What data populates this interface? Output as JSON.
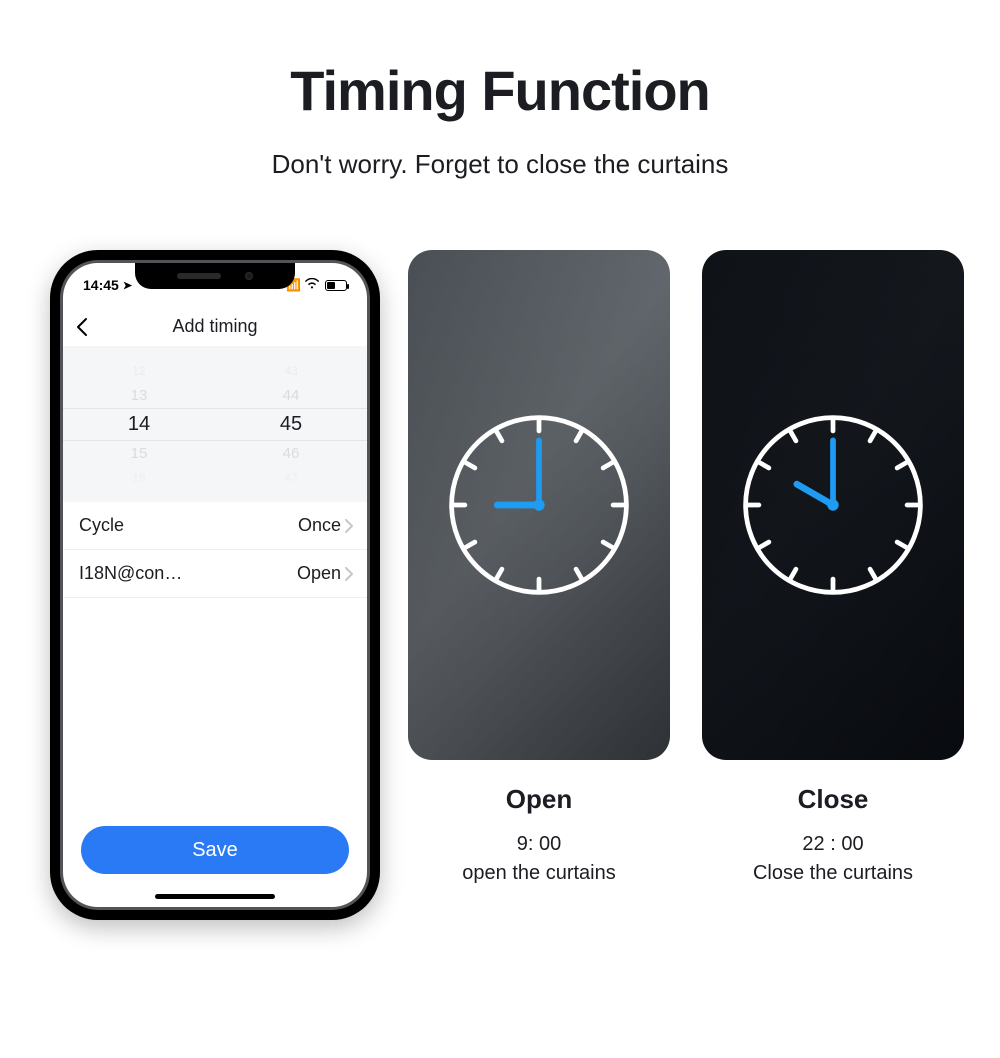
{
  "hero": {
    "title": "Timing Function",
    "subtitle": "Don't worry. Forget to close the curtains"
  },
  "phone": {
    "status_time": "14:45",
    "app_title": "Add timing",
    "picker": {
      "hours": {
        "minus2": "12",
        "minus1": "13",
        "selected": "14",
        "plus1": "15",
        "plus2": "16"
      },
      "minutes": {
        "minus2": "43",
        "minus1": "44",
        "selected": "45",
        "plus1": "46",
        "plus2": "47"
      }
    },
    "rows": [
      {
        "label": "Cycle",
        "value": "Once"
      },
      {
        "label": "I18N@con…",
        "value": "Open"
      }
    ],
    "save_label": "Save"
  },
  "panels": [
    {
      "title": "Open",
      "time": "9: 00",
      "caption": "open the curtains",
      "clock_hour_angle": -90,
      "clock_min_angle": 0,
      "variant": "day"
    },
    {
      "title": "Close",
      "time": "22 : 00",
      "caption": "Close the curtains",
      "clock_hour_angle": -60,
      "clock_min_angle": 0,
      "variant": "night"
    }
  ],
  "colors": {
    "accent": "#2a7af5",
    "clock_hand": "#1E9BF2"
  }
}
